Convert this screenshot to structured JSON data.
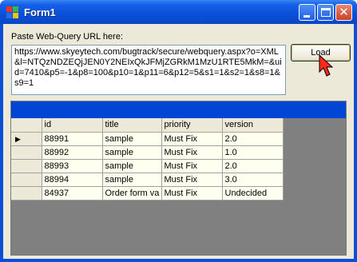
{
  "window": {
    "title": "Form1",
    "controls": {
      "minimize": "_",
      "maximize": "□",
      "close": "✕"
    }
  },
  "form": {
    "url_label": "Paste Web-Query URL here:",
    "url_value": "https://www.skyeytech.com/bugtrack/secure/webquery.aspx?o=XML&l=NTQzNDZEQjJEN0Y2NEIxQkJFMjZGRkM1MzU1RTE5MkM=&uid=7410&p5=-1&p8=100&p10=1&p11=6&p12=5&s1=1&s2=1&s8=1&s9=1",
    "load_label": "Load"
  },
  "grid": {
    "columns": [
      "id",
      "title",
      "priority",
      "version"
    ],
    "rows": [
      {
        "id": "88991",
        "title": "sample",
        "priority": "Must Fix",
        "version": "2.0",
        "current": true
      },
      {
        "id": "88992",
        "title": "sample",
        "priority": "Must Fix",
        "version": "1.0"
      },
      {
        "id": "88993",
        "title": "sample",
        "priority": "Must Fix",
        "version": "2.0"
      },
      {
        "id": "88994",
        "title": "sample",
        "priority": "Must Fix",
        "version": "3.0"
      },
      {
        "id": "84937",
        "title": "Order form va",
        "priority": "Must Fix",
        "version": "Undecided"
      }
    ],
    "current_row_marker": "▶"
  },
  "colors": {
    "titlebar": "#0a50d8",
    "grid_caption": "#0046d5",
    "grid_background": "#808080",
    "cell_background": "#fffff0",
    "form_background": "#ece9d8"
  }
}
